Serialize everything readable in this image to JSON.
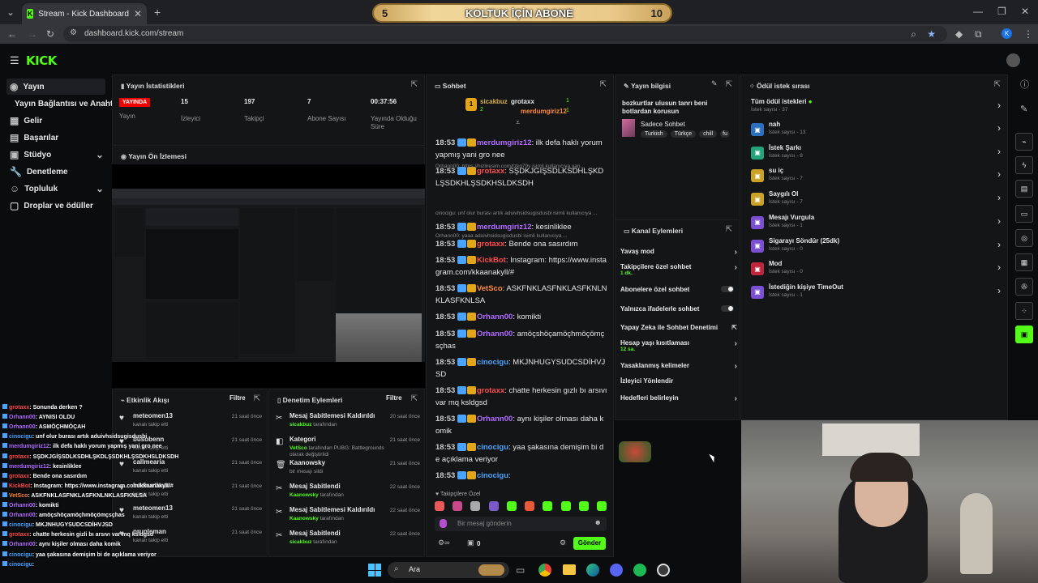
{
  "browser": {
    "tab_title": "Stream - Kick Dashboard",
    "url": "dashboard.kick.com/stream"
  },
  "banner": {
    "left": "5",
    "title": "KOLTUK İÇİN ABONE",
    "right": "10"
  },
  "sidebar": {
    "items": [
      "Yayın",
      "Yayın Bağlantısı ve Anahtarı",
      "Gelir",
      "Başarılar",
      "Stüdyo",
      "Denetleme",
      "Topluluk",
      "Droplar ve ödüller"
    ]
  },
  "stats": {
    "title": "Yayın İstatistikleri",
    "live": "YAYINDA",
    "live_label": "Yayın",
    "viewers": "15",
    "viewers_label": "İzleyici",
    "followers": "197",
    "followers_label": "Takipçi",
    "subs": "7",
    "subs_label": "Abone Sayısı",
    "uptime": "00:37:56",
    "uptime_label": "Yayında Olduğu Süre"
  },
  "preview": {
    "title": "Yayın Ön İzlemesi"
  },
  "feed": {
    "title": "Etkinlik Akışı",
    "filter": "Filtre",
    "items": [
      {
        "name": "meteomen13",
        "sub": "kanalı takip etti",
        "time": "21 saat önce"
      },
      {
        "name": "busobenn",
        "sub": "kanalı takip etti",
        "time": "21 saat önce"
      },
      {
        "name": "callmearia",
        "sub": "kanalı takip etti",
        "time": "21 saat önce"
      },
      {
        "name": "bozkurtbatu",
        "sub": "kanalı takip etti",
        "time": "21 saat önce"
      },
      {
        "name": "meteomen13",
        "sub": "kanalı takip etti",
        "time": "21 saat önce"
      },
      {
        "name": "prupleman",
        "sub": "kanalı takip etti",
        "time": "21 saat önce"
      }
    ]
  },
  "moderation": {
    "title": "Denetim Eylemleri",
    "filter": "Filtre",
    "items": [
      {
        "title": "Mesaj Sabitlemesi Kaldırıldı",
        "user": "sicakbuz",
        "suffix": "tarafından",
        "time": "20 saat önce"
      },
      {
        "title": "Kategori",
        "user": "VetSco",
        "suffix": "tarafından PUBG: Battlegrounds olarak değiştirildi",
        "time": "21 saat önce"
      },
      {
        "title": "Kaanowsky",
        "user": "",
        "suffix": "bir mesajı sildi",
        "time": "21 saat önce"
      },
      {
        "title": "Mesaj Sabitlendi",
        "user": "Kaanowsky",
        "suffix": "tarafından",
        "time": "22 saat önce"
      },
      {
        "title": "Mesaj Sabitlemesi Kaldırıldı",
        "user": "Kaanowsky",
        "suffix": "tarafından",
        "time": "22 saat önce"
      },
      {
        "title": "Mesaj Sabitlendi",
        "user": "sicakbuz",
        "suffix": "tarafından",
        "time": "22 saat önce"
      }
    ]
  },
  "chat": {
    "title": "Sohbet",
    "top_gifters": [
      {
        "name": "sicakbuz",
        "count": "1"
      },
      {
        "name": "grotaxx",
        "count": "1"
      },
      {
        "name": "merdumgiriz12",
        "count": "1"
      }
    ],
    "top_rank": "2",
    "messages": [
      {
        "time": "18:53",
        "user": "merdumgiriz12",
        "color": "#b06cff",
        "text": ": ilk defa haklı yorum yapmış yani gro nee"
      },
      {
        "time": "18:53",
        "user": "grotaxx",
        "color": "#ff4d4d",
        "text": ": SŞDKJGİŞSDLKSDHLŞKDLŞSDKHLŞSDKHSLDKSDH"
      },
      {
        "time": "18:53",
        "user": "merdumgiriz12",
        "color": "#b06cff",
        "text": ": kesinliklee"
      },
      {
        "time": "18:53",
        "user": "grotaxx",
        "color": "#ff4d4d",
        "text": ": Bende ona sasırdım"
      },
      {
        "time": "18:53",
        "user": "KickBot",
        "color": "#ff4d4d",
        "text": ": Instagram: https://www.instagram.com/kkaanakyll/#"
      },
      {
        "time": "18:53",
        "user": "VetSco",
        "color": "#ff8a3d",
        "text": ": ASKFNKLASFNKLASFKNLNKLASFKNLSA"
      },
      {
        "time": "18:53",
        "user": "Orhann00",
        "color": "#b06cff",
        "text": ": komikti"
      },
      {
        "time": "18:53",
        "user": "Orhann00",
        "color": "#b06cff",
        "text": ": amöçshöçamöçhmöçömçsçhas"
      },
      {
        "time": "18:53",
        "user": "cinocigu",
        "color": "#4aa3ff",
        "text": ": MKJNHUGYSUDCSDİHVJSD"
      },
      {
        "time": "18:53",
        "user": "grotaxx",
        "color": "#ff4d4d",
        "text": ": chatte herkesin gızlı bı arsıvı var mq ksldgsd"
      },
      {
        "time": "18:53",
        "user": "Orhann00",
        "color": "#b06cff",
        "text": ": aynı kişiler olması daha komik"
      },
      {
        "time": "18:53",
        "user": "cinocigu",
        "color": "#4aa3ff",
        "text": ": yaa şakasına demişim bi de açıklama veriyor"
      },
      {
        "time": "18:53",
        "user": "cinocigu",
        "color": "#4aa3ff",
        "text": ":"
      }
    ],
    "system": [
      "Orhann00: https://hizliresim.com/tzkg79v isimli kullanıcıya yan...",
      "cinocigu: unf olur burası artık aduivhsidsugisdusbi isimli kullanıcıya ...",
      "Orhann00: yaaa aduivhsidsugisdusbi isimli kullanıcıya ..."
    ],
    "followers_only": "Takipçilere Özel",
    "placeholder": "Bir mesaj gönderin",
    "send": "Gönder",
    "points": "0"
  },
  "info": {
    "title": "Yayın bilgisi",
    "stream_title": "bozkurtlar ulusun tanrı beni botlardan korusun",
    "category": "Sadece Sohbet",
    "tags": [
      "Turkish",
      "Türkçe",
      "chill",
      "fu"
    ]
  },
  "actions": {
    "title": "Kanal Eylemleri",
    "items": [
      "Yavaş mod",
      "Takipçilere özel sohbet",
      "Abonelere özel sohbet",
      "Yalnızca ifadelerle sohbet",
      "Yapay Zeka ile Sohbet Denetimi",
      "Hesap yaşı kısıtlaması",
      "Yasaklanmış kelimeler",
      "İzleyici Yönlendir",
      "Hedefleri belirleyin"
    ],
    "followers_sub": "1 dk.",
    "age_sub": "12 sa."
  },
  "rewards": {
    "title": "Ödül istek sırası",
    "all": "Tüm ödül istekleri",
    "all_count": "İstek sayısı - 37",
    "items": [
      {
        "name": "nah",
        "count": "İstek sayısı - 13",
        "color": "#2d6fbf"
      },
      {
        "name": "İstek Şarkı",
        "count": "İstek sayısı - 8",
        "color": "#22a37a"
      },
      {
        "name": "su iç",
        "count": "İstek sayısı - 7",
        "color": "#c9a227"
      },
      {
        "name": "Saygılı Ol",
        "count": "İstek sayısı - 7",
        "color": "#c9a227"
      },
      {
        "name": "Mesajı Vurgula",
        "count": "İstek sayısı - 1",
        "color": "#7b4fd1"
      },
      {
        "name": "Sigarayı Söndür (25dk)",
        "count": "İstek sayısı - 0",
        "color": "#7b4fd1"
      },
      {
        "name": "Mod",
        "count": "İstek sayısı - 0",
        "color": "#c0263b"
      },
      {
        "name": "İstediğin kişiye TimeOut",
        "count": "İstek sayısı - 1",
        "color": "#7b4fd1"
      }
    ]
  },
  "overlay": [
    {
      "user": "grotaxx",
      "color": "#ff4d4d",
      "text": ": Sonunda derken ?"
    },
    {
      "user": "Orhann00",
      "color": "#b06cff",
      "text": ": AYNISI OLDU"
    },
    {
      "user": "Orhann00",
      "color": "#b06cff",
      "text": ": ASMÖÇHMÖÇAH"
    },
    {
      "user": "cinocigu",
      "color": "#4aa3ff",
      "text": ": unf olur burası artık aduivhsidsugisdusbi"
    },
    {
      "user": "merdumgiriz12",
      "color": "#b06cff",
      "text": ": ilk defa haklı yorum yapmış yani gro nee"
    },
    {
      "user": "grotaxx",
      "color": "#ff4d4d",
      "text": ": SŞDKJGİŞSDLKSDHLŞKDLŞSDKHLŞSDKHSLDKSDH"
    },
    {
      "user": "merdumgiriz12",
      "color": "#b06cff",
      "text": ": kesinliklee"
    },
    {
      "user": "grotaxx",
      "color": "#ff4d4d",
      "text": ": Bende ona sasırdım"
    },
    {
      "user": "KickBot",
      "color": "#ff4d4d",
      "text": ": Instagram: https://www.instagram.com/kkaanakyll/#"
    },
    {
      "user": "VetSco",
      "color": "#ff8a3d",
      "text": ": ASKFNKLASFNKLASFKNLNKLASFKNLSA"
    },
    {
      "user": "Orhann00",
      "color": "#b06cff",
      "text": ": komikti"
    },
    {
      "user": "Orhann00",
      "color": "#b06cff",
      "text": ": amöçshöçamöçhmöçömçsçhas"
    },
    {
      "user": "cinocigu",
      "color": "#4aa3ff",
      "text": ": MKJNHUGYSUDCSDİHVJSD"
    },
    {
      "user": "grotaxx",
      "color": "#ff4d4d",
      "text": ": chatte herkesin gizli bı arsıvı var mq ksldgsd"
    },
    {
      "user": "Orhann00",
      "color": "#b06cff",
      "text": ": aynı kişiler olması daha komik"
    },
    {
      "user": "cinocigu",
      "color": "#4aa3ff",
      "text": ": yaa şakasına demişim bi de açıklama veriyor"
    },
    {
      "user": "cinocigu",
      "color": "#4aa3ff",
      "text": ":"
    }
  ],
  "taskbar": {
    "search": "Ara"
  },
  "colors": {
    "accent": "#53fc18",
    "bg": "#0b0c0d",
    "panel": "#141517"
  }
}
